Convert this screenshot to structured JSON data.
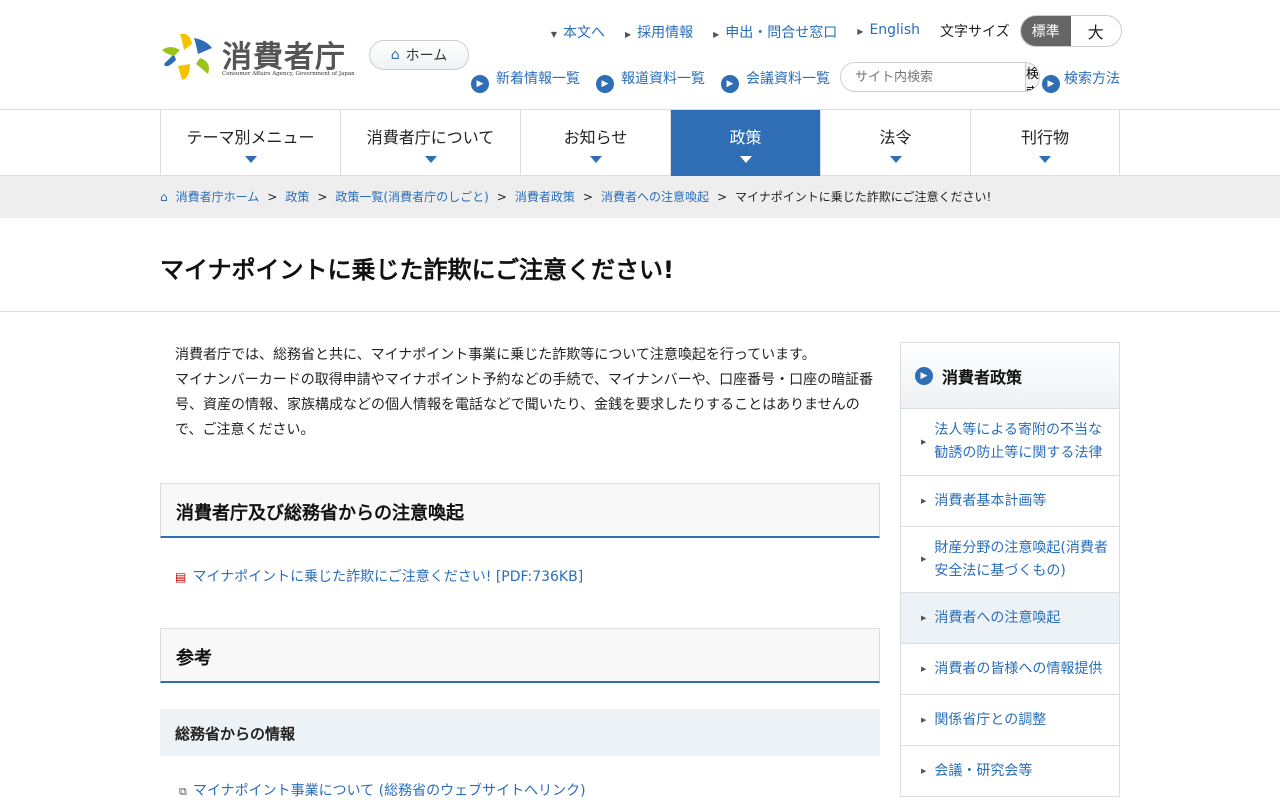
{
  "header": {
    "logo_name": "消費者庁",
    "logo_sub": "Consumer Affairs Agency, Government of Japan",
    "home": "ホーム",
    "top_links": [
      "本文へ",
      "採用情報",
      "申出・問合せ窓口",
      "English"
    ],
    "font_size_label": "文字サイズ",
    "font_sizes": [
      "標準",
      "大"
    ],
    "sub_links": [
      "新着情報一覧",
      "報道資料一覧",
      "会議資料一覧"
    ],
    "search_placeholder": "サイト内検索",
    "search_button": "検索",
    "search_help": "検索方法"
  },
  "nav": [
    "テーマ別メニュー",
    "消費者庁について",
    "お知らせ",
    "政策",
    "法令",
    "刊行物"
  ],
  "breadcrumb": [
    "消費者庁ホーム",
    "政策",
    "政策一覧(消費者庁のしごと)",
    "消費者政策",
    "消費者への注意喚起",
    "マイナポイントに乗じた詐欺にご注意ください!"
  ],
  "main": {
    "title": "マイナポイントに乗じた詐欺にご注意ください!",
    "intro1": "消費者庁では、総務省と共に、マイナポイント事業に乗じた詐欺等について注意喚起を行っています。",
    "intro2": "マイナンバーカードの取得申請やマイナポイント予約などの手続で、マイナンバーや、口座番号・口座の暗証番号、資産の情報、家族構成などの個人情報を電話などで聞いたり、金銭を要求したりすることはありませんので、ご注意ください。",
    "section1": "消費者庁及び総務省からの注意喚起",
    "pdf_link": "マイナポイントに乗じた詐欺にご注意ください! [PDF:736KB]",
    "section2": "参考",
    "sub_heading": "総務省からの情報",
    "ext_link": "マイナポイント事業について (総務省のウェブサイトへリンク)"
  },
  "sidebar": {
    "title": "消費者政策",
    "items": [
      "法人等による寄附の不当な勧誘の防止等に関する法律",
      "消費者基本計画等",
      "財産分野の注意喚起(消費者安全法に基づくもの)",
      "消費者への注意喚起",
      "消費者の皆様への情報提供",
      "関係省庁との調整",
      "会議・研究会等"
    ]
  }
}
